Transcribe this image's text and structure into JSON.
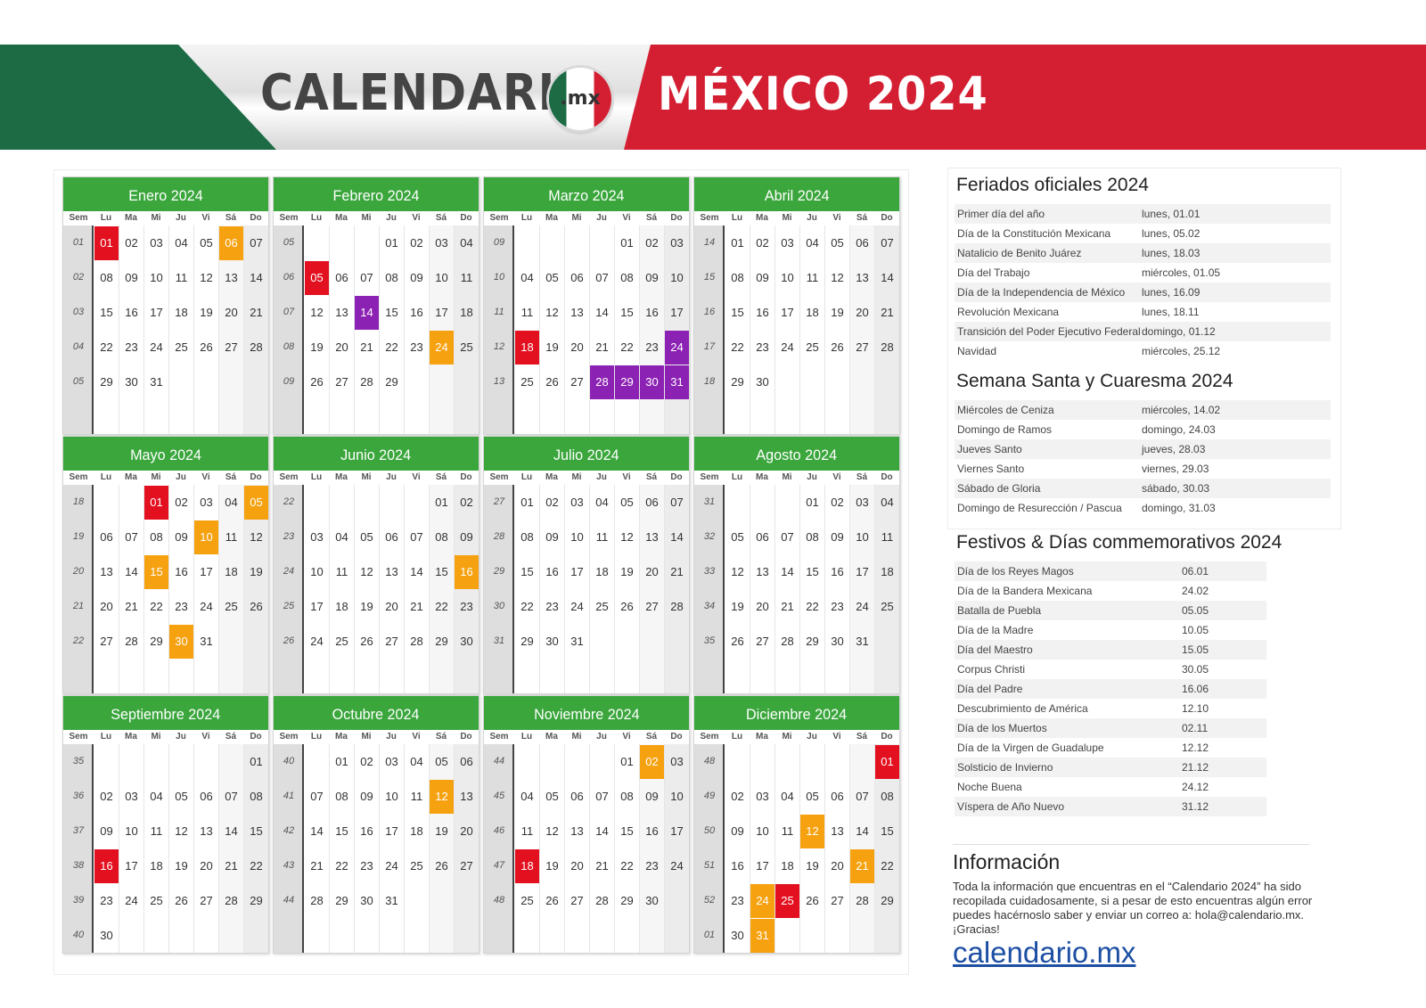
{
  "header": {
    "brand": "CALENDARIO",
    "brand_badge": ".mx",
    "title": "MÉXICO 2024"
  },
  "weekday_labels": [
    "Sem",
    "Lu",
    "Ma",
    "Mi",
    "Ju",
    "Vi",
    "Sá",
    "Do"
  ],
  "colors": {
    "red": "#e3101f",
    "orange": "#f6a10f",
    "purple": "#8c22b3",
    "month_header": "#3aa63c"
  },
  "months": [
    {
      "title": "Enero 2024",
      "offset": 0,
      "days": 31,
      "week_start": 1,
      "highlights": [
        {
          "day": 1,
          "color": "red"
        },
        {
          "day": 6,
          "color": "orange"
        }
      ]
    },
    {
      "title": "Febrero 2024",
      "offset": 3,
      "days": 29,
      "week_start": 5,
      "highlights": [
        {
          "day": 5,
          "color": "red"
        },
        {
          "day": 14,
          "color": "purple"
        },
        {
          "day": 24,
          "color": "orange"
        }
      ]
    },
    {
      "title": "Marzo 2024",
      "offset": 4,
      "days": 31,
      "week_start": 9,
      "highlights": [
        {
          "day": 18,
          "color": "red"
        },
        {
          "day": 24,
          "color": "purple"
        },
        {
          "day": 28,
          "color": "purple"
        },
        {
          "day": 29,
          "color": "purple"
        },
        {
          "day": 30,
          "color": "purple"
        },
        {
          "day": 31,
          "color": "purple"
        }
      ]
    },
    {
      "title": "Abril 2024",
      "offset": 0,
      "days": 30,
      "week_start": 14,
      "highlights": []
    },
    {
      "title": "Mayo 2024",
      "offset": 2,
      "days": 31,
      "week_start": 18,
      "highlights": [
        {
          "day": 1,
          "color": "red"
        },
        {
          "day": 5,
          "color": "orange"
        },
        {
          "day": 10,
          "color": "orange"
        },
        {
          "day": 15,
          "color": "orange"
        },
        {
          "day": 30,
          "color": "orange"
        }
      ]
    },
    {
      "title": "Junio 2024",
      "offset": 5,
      "days": 30,
      "week_start": 22,
      "highlights": [
        {
          "day": 16,
          "color": "orange"
        }
      ]
    },
    {
      "title": "Julio 2024",
      "offset": 0,
      "days": 31,
      "week_start": 27,
      "highlights": []
    },
    {
      "title": "Agosto 2024",
      "offset": 3,
      "days": 31,
      "week_start": 31,
      "highlights": []
    },
    {
      "title": "Septiembre 2024",
      "offset": 6,
      "days": 30,
      "week_start": 35,
      "highlights": [
        {
          "day": 16,
          "color": "red"
        }
      ]
    },
    {
      "title": "Octubre 2024",
      "offset": 1,
      "days": 31,
      "week_start": 40,
      "highlights": [
        {
          "day": 12,
          "color": "orange"
        }
      ]
    },
    {
      "title": "Noviembre 2024",
      "offset": 4,
      "days": 30,
      "week_start": 44,
      "highlights": [
        {
          "day": 2,
          "color": "orange"
        },
        {
          "day": 18,
          "color": "red"
        }
      ]
    },
    {
      "title": "Diciembre 2024",
      "offset": 6,
      "days": 31,
      "week_start": 48,
      "week_last": "01",
      "highlights": [
        {
          "day": 1,
          "color": "red"
        },
        {
          "day": 12,
          "color": "orange"
        },
        {
          "day": 21,
          "color": "orange"
        },
        {
          "day": 24,
          "color": "orange"
        },
        {
          "day": 25,
          "color": "red"
        },
        {
          "day": 31,
          "color": "orange"
        }
      ]
    }
  ],
  "feriados": {
    "title": "Feriados oficiales 2024",
    "items": [
      {
        "name": "Primer día del año",
        "date": "lunes, 01.01"
      },
      {
        "name": "Día de la Constitución Mexicana",
        "date": "lunes, 05.02"
      },
      {
        "name": "Natalicio de Benito Juárez",
        "date": "lunes, 18.03"
      },
      {
        "name": "Día del Trabajo",
        "date": "miércoles, 01.05"
      },
      {
        "name": "Día de la Independencia de México",
        "date": "lunes, 16.09"
      },
      {
        "name": "Revolución Mexicana",
        "date": "lunes, 18.11"
      },
      {
        "name": "Transición del Poder Ejecutivo Federal",
        "date": "domingo, 01.12"
      },
      {
        "name": "Navidad",
        "date": "miércoles, 25.12"
      }
    ]
  },
  "semana_santa": {
    "title": "Semana Santa y Cuaresma 2024",
    "items": [
      {
        "name": "Miércoles de Ceniza",
        "date": "miércoles, 14.02"
      },
      {
        "name": "Domingo de Ramos",
        "date": "domingo, 24.03"
      },
      {
        "name": "Jueves Santo",
        "date": "jueves, 28.03"
      },
      {
        "name": "Viernes Santo",
        "date": "viernes, 29.03"
      },
      {
        "name": "Sábado de Gloria",
        "date": "sábado, 30.03"
      },
      {
        "name": "Domingo de Resurección / Pascua",
        "date": "domingo, 31.03"
      }
    ]
  },
  "festivos": {
    "title": "Festivos & Días commemorativos 2024",
    "items": [
      {
        "name": "Día de los Reyes Magos",
        "date": "06.01"
      },
      {
        "name": "Día de la Bandera Mexicana",
        "date": "24.02"
      },
      {
        "name": "Batalla de Puebla",
        "date": "05.05"
      },
      {
        "name": "Día de la Madre",
        "date": "10.05"
      },
      {
        "name": "Día del Maestro",
        "date": "15.05"
      },
      {
        "name": "Corpus Christi",
        "date": "30.05"
      },
      {
        "name": "Día del Padre",
        "date": "16.06"
      },
      {
        "name": "Descubrimiento de América",
        "date": "12.10"
      },
      {
        "name": "Día de los Muertos",
        "date": "02.11"
      },
      {
        "name": "Día de la Virgen de Guadalupe",
        "date": "12.12"
      },
      {
        "name": "Solsticio de Invierno",
        "date": "21.12"
      },
      {
        "name": "Noche Buena",
        "date": "24.12"
      },
      {
        "name": "Víspera de Año Nuevo",
        "date": "31.12"
      }
    ]
  },
  "info": {
    "title": "Información",
    "text": "Toda la información que encuentras en el “Calendario 2024” ha sido recopilada cuidadosamente, si a pesar de esto encuentras algún error puedes hacérnoslo saber y enviar un correo a: hola@calendario.mx. ¡Gracias!",
    "link": "calendario.mx"
  }
}
